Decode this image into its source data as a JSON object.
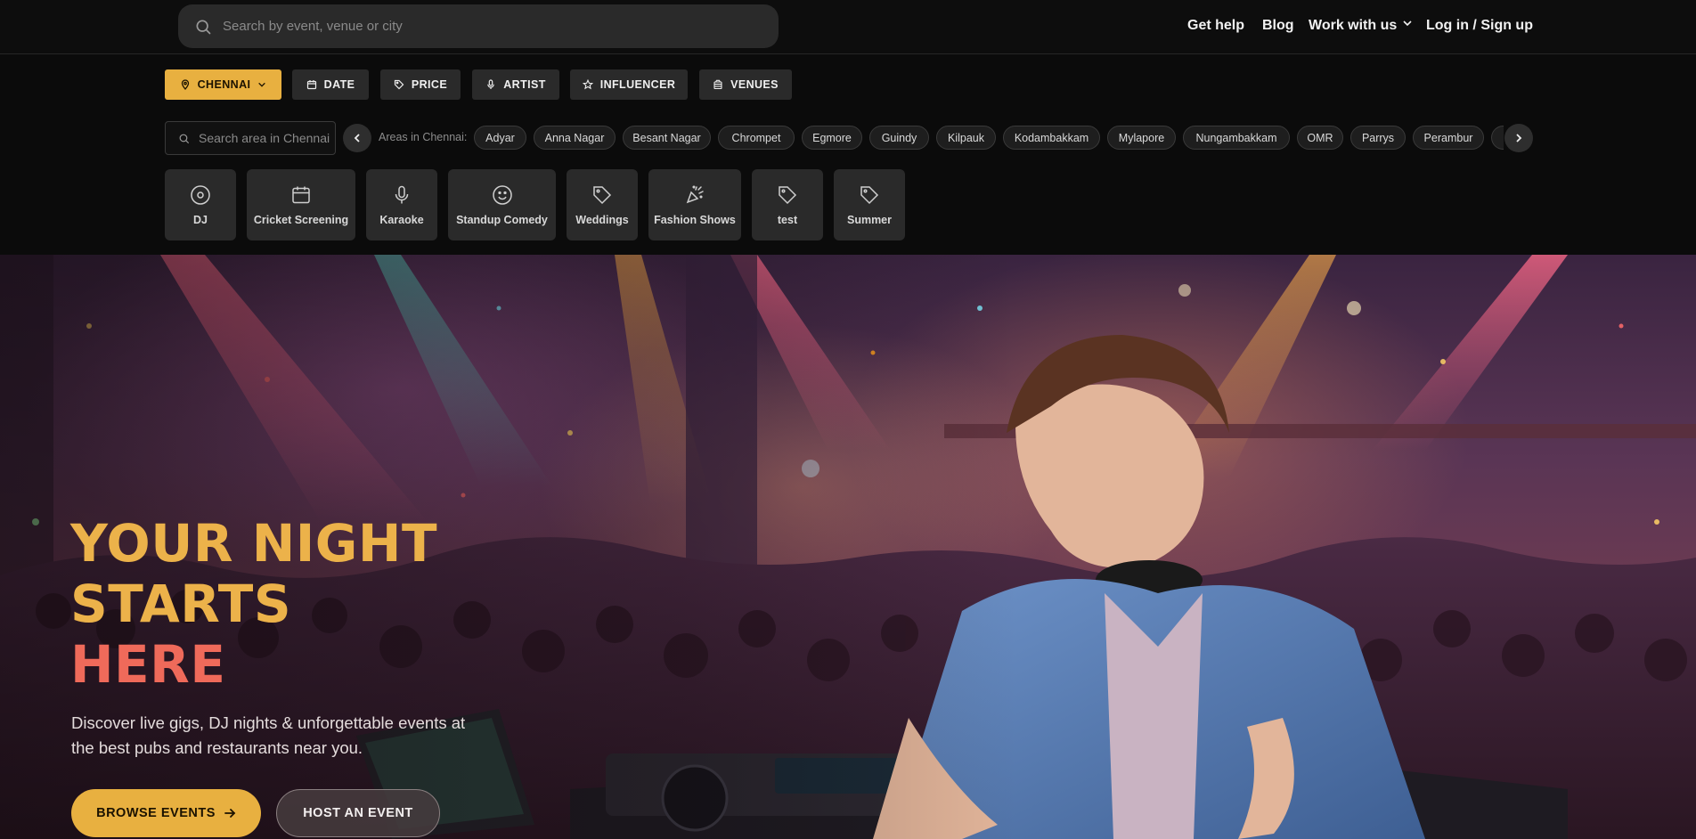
{
  "header": {
    "search_placeholder": "Search by event, venue or city",
    "links": [
      "Get help",
      "Blog",
      "Work with us",
      "Log in / Sign up"
    ]
  },
  "filters": {
    "city": "CHENNAI",
    "date": "DATE",
    "price": "PRICE",
    "artist": "ARTIST",
    "influencer": "INFLUENCER",
    "venues": "VENUES"
  },
  "areas": {
    "search_placeholder": "Search area in Chennai",
    "label": "Areas in Chennai:",
    "items": [
      "Adyar",
      "Anna Nagar",
      "Besant Nagar",
      "Chrompet",
      "Egmore",
      "Guindy",
      "Kilpauk",
      "Kodambakkam",
      "Mylapore",
      "Nungambakkam",
      "OMR",
      "Parrys",
      "Perambur"
    ]
  },
  "categories": [
    {
      "label": "DJ",
      "icon": "disc-icon"
    },
    {
      "label": "Cricket Screening",
      "icon": "calendar-icon"
    },
    {
      "label": "Karaoke",
      "icon": "microphone-icon"
    },
    {
      "label": "Standup Comedy",
      "icon": "smile-icon"
    },
    {
      "label": "Weddings",
      "icon": "tag-icon"
    },
    {
      "label": "Fashion Shows",
      "icon": "party-popper-icon"
    },
    {
      "label": "test",
      "icon": "tag-icon"
    },
    {
      "label": "Summer",
      "icon": "tag-icon"
    }
  ],
  "hero": {
    "line1": "YOUR NIGHT",
    "line2": "STARTS",
    "line3": "HERE",
    "subtext": "Discover live gigs, DJ nights & unforgettable events at the best pubs and restaurants near you.",
    "browse_label": "BROWSE EVENTS",
    "host_label": "HOST AN EVENT"
  },
  "colors": {
    "accent": "#e8b040",
    "headline_gold": "#ecb24a",
    "headline_red": "#ef6a5a",
    "chip_bg": "#2a2a2a",
    "page_bg": "#0b0b0b"
  }
}
